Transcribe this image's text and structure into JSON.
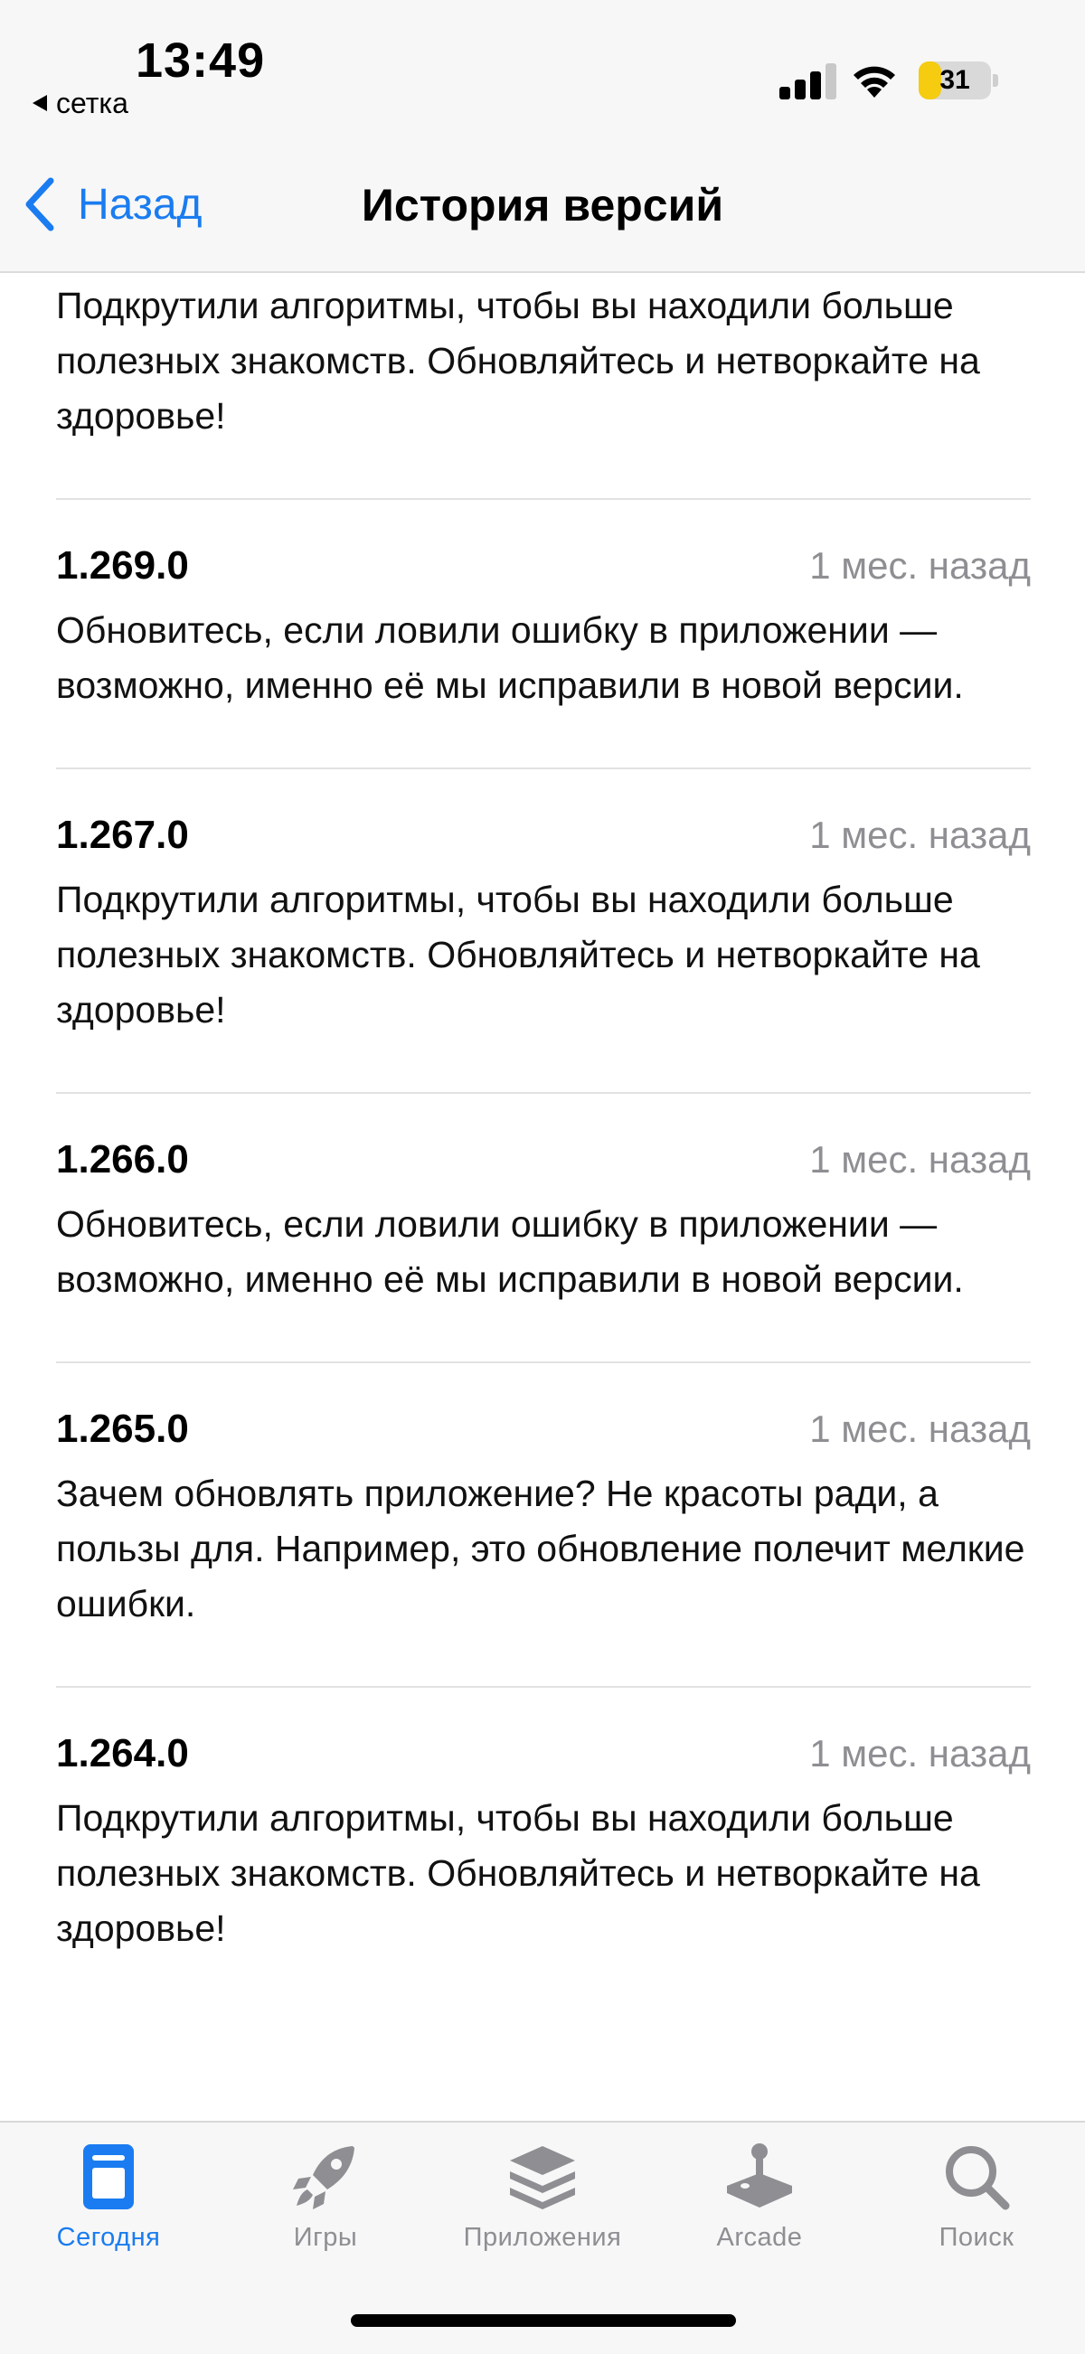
{
  "status_bar": {
    "time": "13:49",
    "back_app": "сетка",
    "battery": "31",
    "battery_level": 0.31
  },
  "nav": {
    "back_label": "Назад",
    "title": "История версий"
  },
  "colors": {
    "accent": "#1a7cf0",
    "secondary_text": "#8e8e93",
    "battery": "#f5cc10"
  },
  "partial_entry": {
    "notes": "Подкрутили алгоритмы, чтобы вы находили больше полезных знакомств. Обновляйтесь и нетворкайте на здоровье!"
  },
  "entries": [
    {
      "version": "1.269.0",
      "ago": "1 мес. назад",
      "notes": "Обновитесь, если ловили ошибку в приложении — возможно, именно её мы исправили в новой версии."
    },
    {
      "version": "1.267.0",
      "ago": "1 мес. назад",
      "notes": "Подкрутили алгоритмы, чтобы вы находили больше полезных знакомств. Обновляйтесь и нетворкайте на здоровье!"
    },
    {
      "version": "1.266.0",
      "ago": "1 мес. назад",
      "notes": "Обновитесь, если ловили ошибку в приложении — возможно, именно её мы исправили в новой версии."
    },
    {
      "version": "1.265.0",
      "ago": "1 мес. назад",
      "notes": "Зачем обновлять приложение? Не красоты ради, а пользы для. Например, это обновление полечит мелкие ошибки."
    },
    {
      "version": "1.264.0",
      "ago": "1 мес. назад",
      "notes": "Подкрутили алгоритмы, чтобы вы находили больше полезных знакомств. Обновляйтесь и нетворкайте на здоровье!"
    }
  ],
  "tabs": [
    {
      "label": "Сегодня",
      "icon": "today-icon",
      "active": true
    },
    {
      "label": "Игры",
      "icon": "rocket-icon",
      "active": false
    },
    {
      "label": "Приложения",
      "icon": "apps-stack-icon",
      "active": false
    },
    {
      "label": "Arcade",
      "icon": "joystick-icon",
      "active": false
    },
    {
      "label": "Поиск",
      "icon": "search-icon",
      "active": false
    }
  ]
}
